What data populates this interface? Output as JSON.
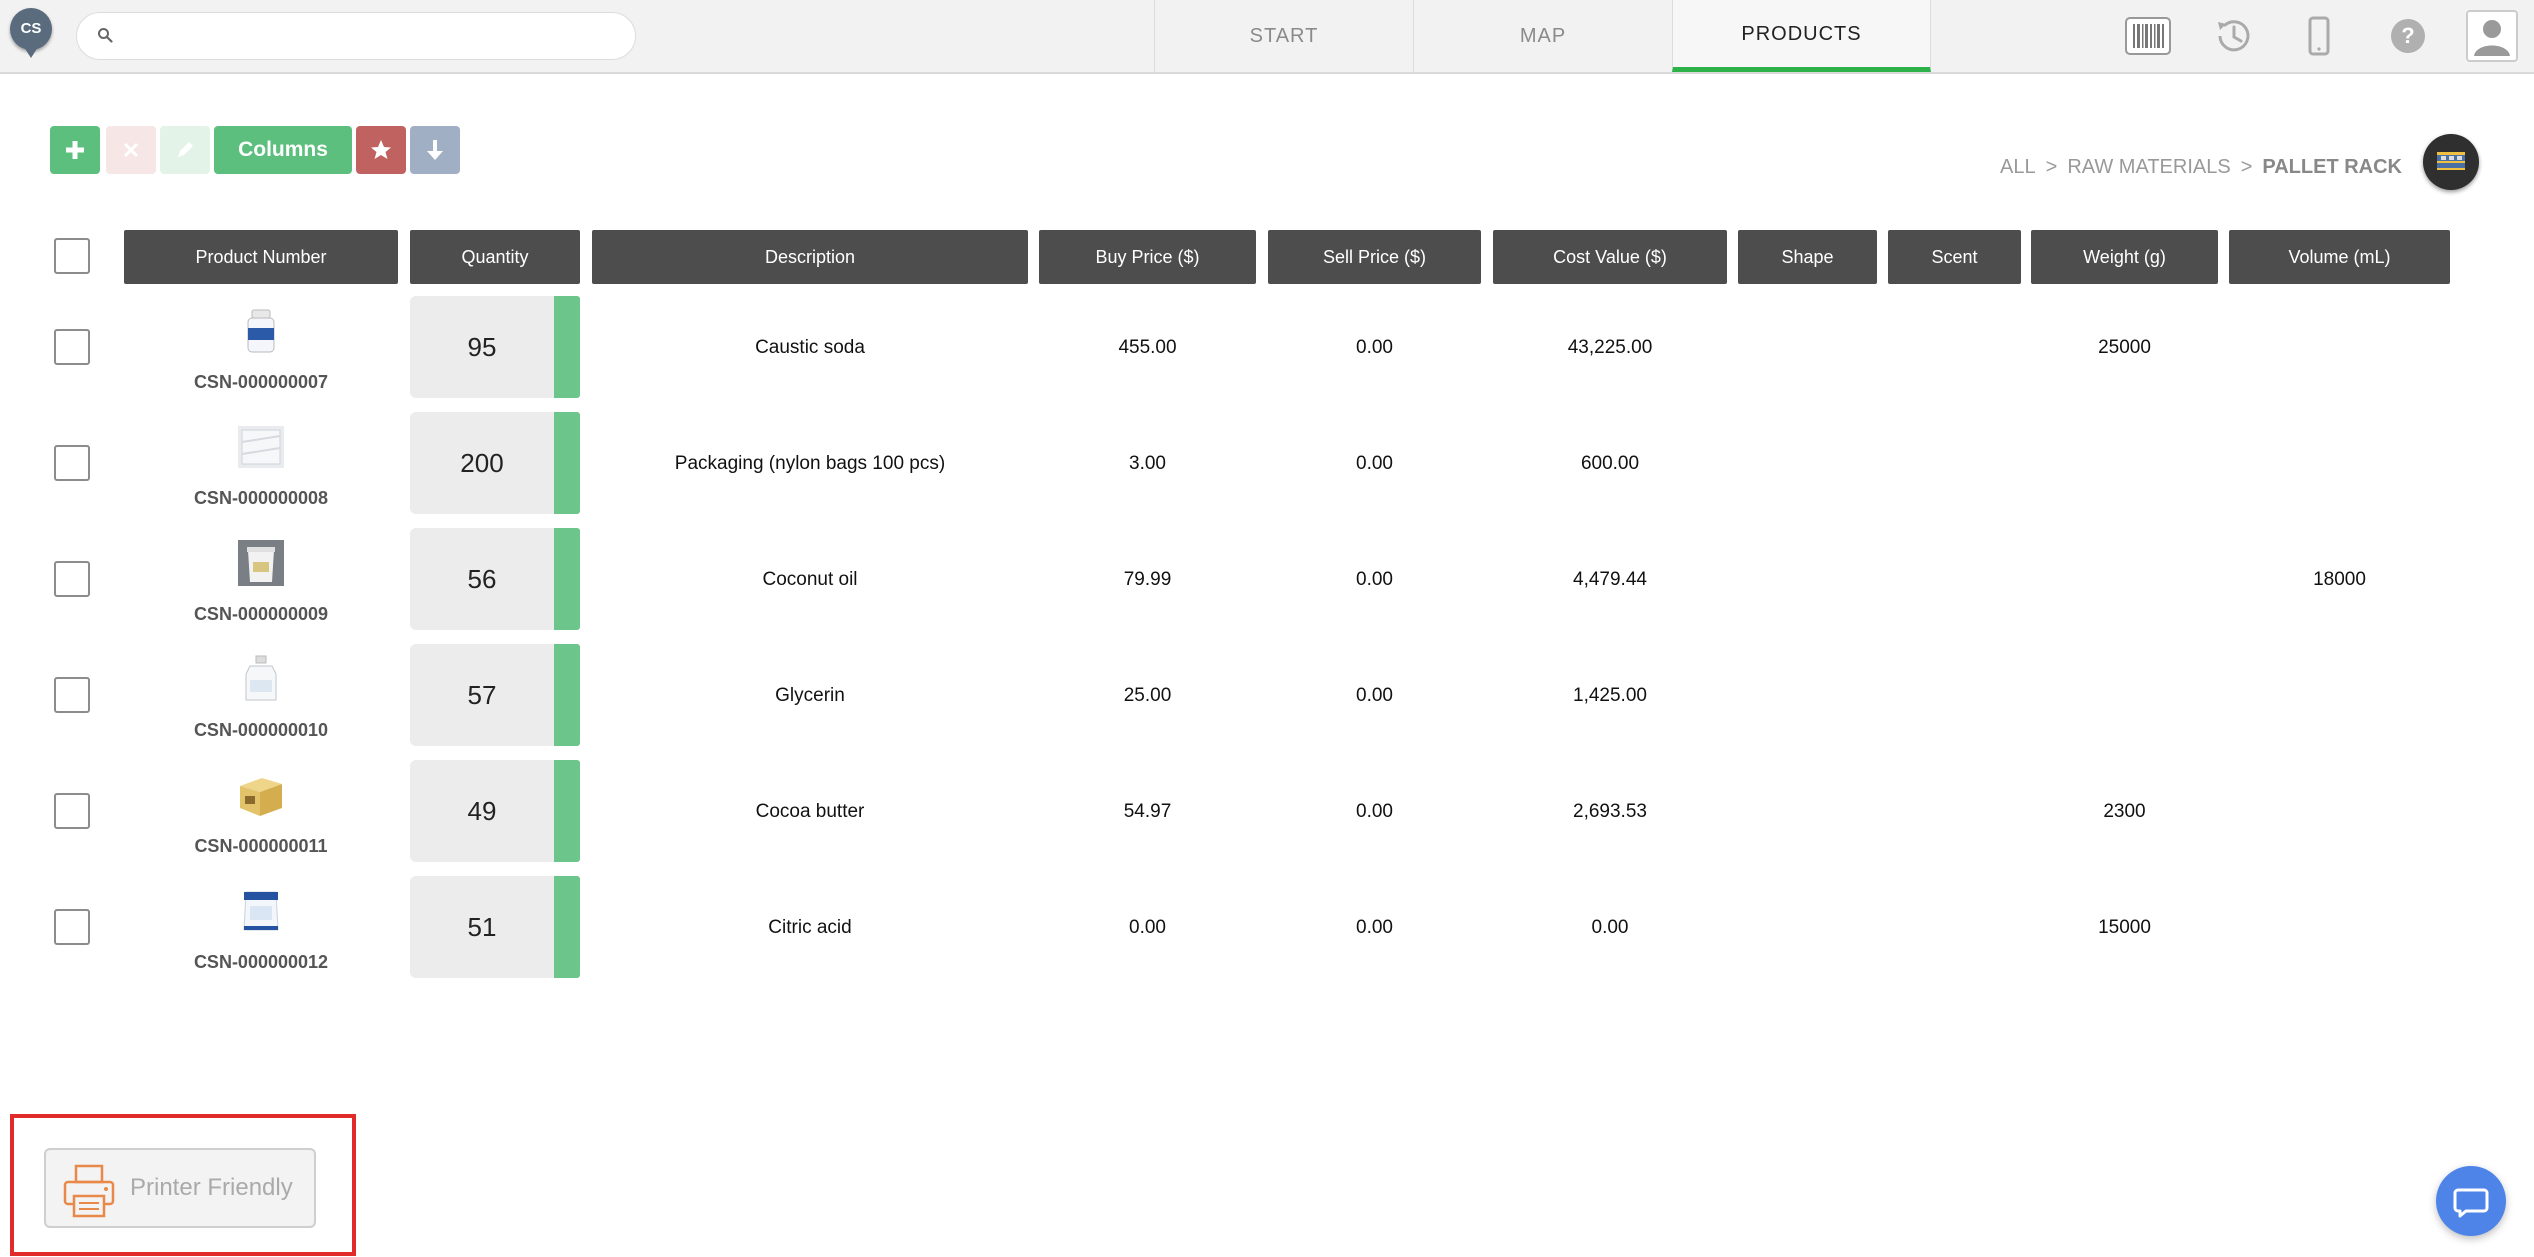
{
  "app": {
    "logo_text": "CS"
  },
  "search": {
    "placeholder": "",
    "value": ""
  },
  "nav": {
    "tabs": [
      "START",
      "MAP",
      "PRODUCTS"
    ],
    "active": "PRODUCTS"
  },
  "toolbar": {
    "columns_label": "Columns"
  },
  "breadcrumb": {
    "items": [
      "ALL",
      "RAW MATERIALS"
    ],
    "separator": ">",
    "current": "PALLET RACK"
  },
  "table": {
    "headers": [
      "Product Number",
      "Quantity",
      "Description",
      "Buy Price ($)",
      "Sell Price ($)",
      "Cost Value ($)",
      "Shape",
      "Scent",
      "Weight (g)",
      "Volume (mL)"
    ],
    "rows": [
      {
        "product_number": "CSN-000000007",
        "thumb": "bottle-icon",
        "quantity": "95",
        "description": "Caustic soda",
        "buy": "455.00",
        "sell": "0.00",
        "cost": "43,225.00",
        "shape": "",
        "scent": "",
        "weight": "25000",
        "volume": ""
      },
      {
        "product_number": "CSN-000000008",
        "thumb": "bags-icon",
        "quantity": "200",
        "description": "Packaging (nylon bags 100 pcs)",
        "buy": "3.00",
        "sell": "0.00",
        "cost": "600.00",
        "shape": "",
        "scent": "",
        "weight": "",
        "volume": ""
      },
      {
        "product_number": "CSN-000000009",
        "thumb": "tub-icon",
        "quantity": "56",
        "description": "Coconut oil",
        "buy": "79.99",
        "sell": "0.00",
        "cost": "4,479.44",
        "shape": "",
        "scent": "",
        "weight": "",
        "volume": "18000"
      },
      {
        "product_number": "CSN-000000010",
        "thumb": "jug-icon",
        "quantity": "57",
        "description": "Glycerin",
        "buy": "25.00",
        "sell": "0.00",
        "cost": "1,425.00",
        "shape": "",
        "scent": "",
        "weight": "",
        "volume": ""
      },
      {
        "product_number": "CSN-000000011",
        "thumb": "butter-box-icon",
        "quantity": "49",
        "description": "Cocoa butter",
        "buy": "54.97",
        "sell": "0.00",
        "cost": "2,693.53",
        "shape": "",
        "scent": "",
        "weight": "2300",
        "volume": ""
      },
      {
        "product_number": "CSN-000000012",
        "thumb": "sack-icon",
        "quantity": "51",
        "description": "Citric acid",
        "buy": "0.00",
        "sell": "0.00",
        "cost": "0.00",
        "shape": "",
        "scent": "",
        "weight": "15000",
        "volume": ""
      }
    ]
  },
  "printer": {
    "label": "Printer Friendly"
  },
  "colors": {
    "accent_green": "#2db24a",
    "button_green": "#5cbf7e",
    "quantity_bar": "#6cc58a",
    "header_gray": "#4d4d4d",
    "star_red": "#c0625f",
    "download_blue": "#a0afc4",
    "highlight_red": "#e12b2b",
    "printer_orange": "#e8894a",
    "chat_blue": "#4e84e8"
  }
}
